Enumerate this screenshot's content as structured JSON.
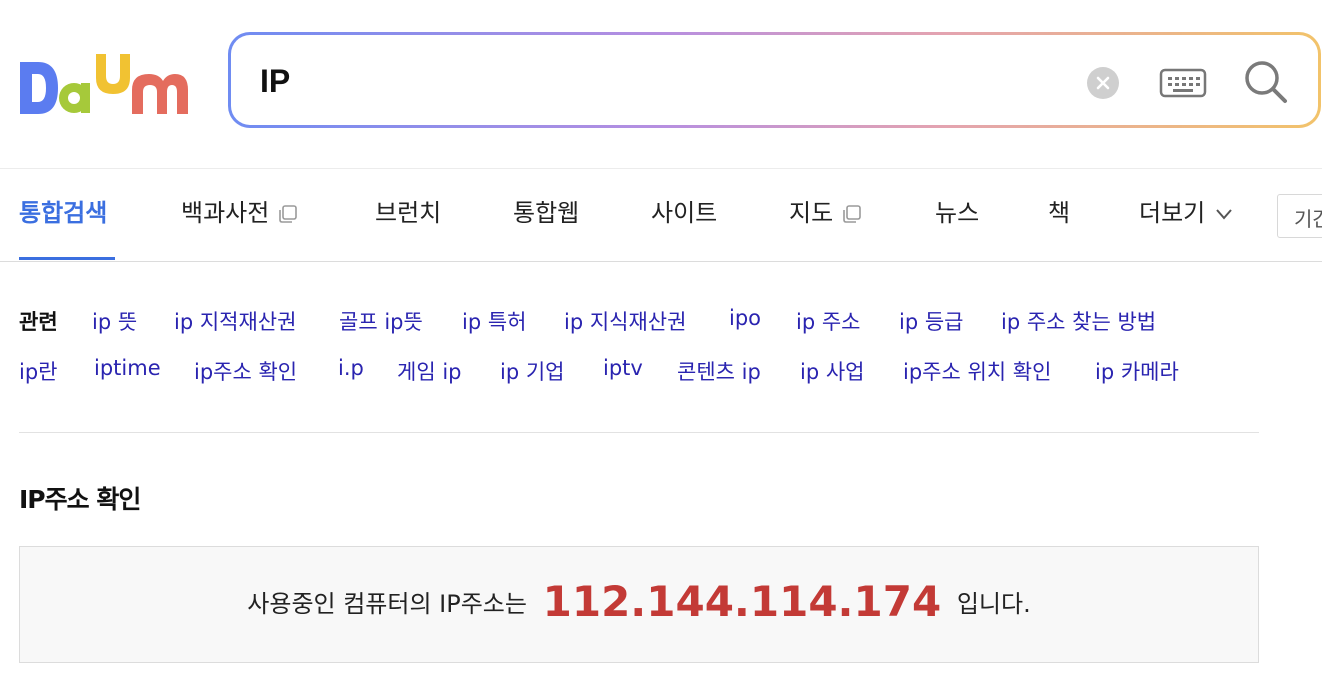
{
  "logo": {
    "text": "Daum",
    "colors": [
      "#5b7cf0",
      "#f1c232",
      "#a6c93a",
      "#e46c5e"
    ]
  },
  "search": {
    "query": "IP",
    "border_gradient": [
      "#6f8cf2",
      "#b78fe0",
      "#e3a3b1",
      "#f2c36a"
    ]
  },
  "tabs": [
    {
      "label": "통합검색",
      "active": true
    },
    {
      "label": "백과사전",
      "popup": true
    },
    {
      "label": "브런치"
    },
    {
      "label": "통합웹"
    },
    {
      "label": "사이트"
    },
    {
      "label": "지도",
      "popup": true
    },
    {
      "label": "뉴스"
    },
    {
      "label": "책"
    },
    {
      "label": "더보기",
      "dropdown": true
    }
  ],
  "criteria_label": "기간",
  "related": {
    "label": "관련",
    "row1": [
      "ip 뜻",
      "ip 지적재산권",
      "골프 ip뜻",
      "ip 특허",
      "ip 지식재산권",
      "ipo",
      "ip 주소",
      "ip 등급",
      "ip 주소 찾는 방법"
    ],
    "row2": [
      "ip란",
      "iptime",
      "ip주소 확인",
      "i.p",
      "게임 ip",
      "ip 기업",
      "iptv",
      "콘텐츠 ip",
      "ip 사업",
      "ip주소 위치 확인",
      "ip 카메라"
    ]
  },
  "ip_section": {
    "title": "IP주소 확인",
    "prefix": "사용중인 컴퓨터의 IP주소는",
    "address": "112.144.114.174",
    "suffix": "입니다."
  },
  "colors": {
    "accent": "#3b6fe0",
    "link": "#2a24b0",
    "ip": "#c33a36"
  }
}
